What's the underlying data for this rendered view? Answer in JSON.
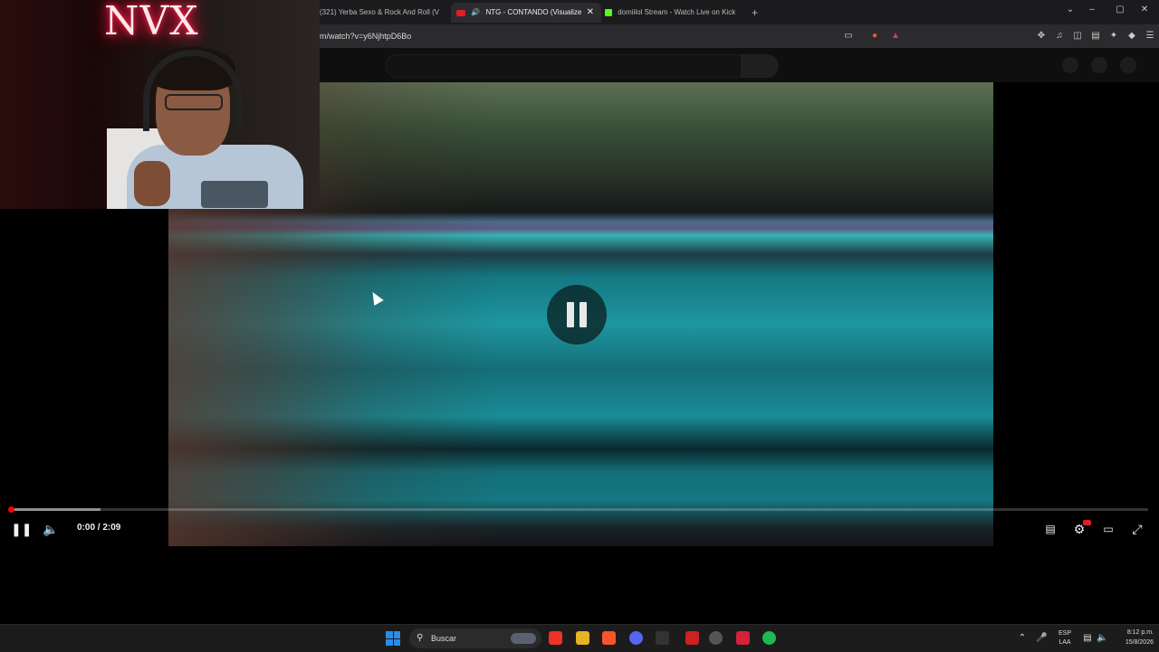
{
  "browser": {
    "tabs": [
      {
        "label": "(321) Yerba Sexo & Rock And Roll (V"
      },
      {
        "label": "NTG - CONTANDO (Visualize",
        "active": true
      },
      {
        "label": "domiilol Stream - Watch Live on Kick"
      }
    ],
    "new_tab": "+",
    "url": "m/watch?v=y6NjhtpD6Bo"
  },
  "webcam": {
    "neon_sign": "NVX"
  },
  "player": {
    "time": "0:00 / 2:09",
    "progress_fraction": 0.0,
    "buffered_fraction": 0.08,
    "state": "paused-overlay",
    "icons": {
      "play_pause": "pause-icon",
      "volume": "volume-icon",
      "subtitles": "subtitles-icon",
      "settings": "settings-icon",
      "theater": "theater-mode-icon",
      "fullscreen": "fullscreen-icon"
    }
  },
  "taskbar": {
    "search_label": "Buscar",
    "language": "ESP\nLAA",
    "lang_top": "ESP",
    "lang_bottom": "LAA",
    "time": "8:12 p.m.",
    "date": "15/8/2026"
  },
  "colors": {
    "progress": "#ff0000",
    "windows_accent": "#2a8ce6",
    "brave": "#fb542b",
    "kick": "#53fc18",
    "spotify": "#1db954"
  }
}
